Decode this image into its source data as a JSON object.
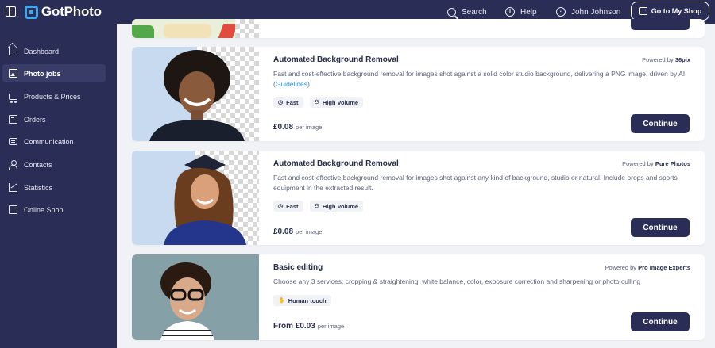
{
  "header": {
    "logo": "GotPhoto",
    "search_label": "Search",
    "help_label": "Help",
    "user_name": "John Johnson",
    "shop_button": "Go to My Shop"
  },
  "sidebar": {
    "items": [
      {
        "label": "Dashboard",
        "icon": "home-icon"
      },
      {
        "label": "Photo jobs",
        "icon": "photo-icon",
        "active": true
      },
      {
        "label": "Products & Prices",
        "icon": "cart-icon"
      },
      {
        "label": "Orders",
        "icon": "box-icon"
      },
      {
        "label": "Communication",
        "icon": "chat-icon"
      },
      {
        "label": "Contacts",
        "icon": "person-icon"
      },
      {
        "label": "Statistics",
        "icon": "stats-icon"
      },
      {
        "label": "Online Shop",
        "icon": "store-icon"
      }
    ]
  },
  "cards": [
    {
      "title": "Automated Background Removal",
      "powered_prefix": "Powered by",
      "powered_by": "36pix",
      "description": "Fast and cost-effective background removal for images shot against a solid color studio background, delivering a PNG image, driven by AI. (",
      "link": "Guidelines",
      "description_end": ")",
      "tags": [
        "Fast",
        "High Volume"
      ],
      "price": "£0.08",
      "price_unit": "per image",
      "button": "Continue"
    },
    {
      "title": "Automated Background Removal",
      "powered_prefix": "Powered by",
      "powered_by": "Pure Photos",
      "description": "Fast and cost-effective background removal for images shot against any kind of background, studio or natural. Include props and sports equipment in the extracted result.",
      "tags": [
        "Fast",
        "High Volume"
      ],
      "price": "£0.08",
      "price_unit": "per image",
      "button": "Continue"
    },
    {
      "title": "Basic editing",
      "powered_prefix": "Powered by",
      "powered_by": "Pro Image Experts",
      "description": "Choose any 3 services: cropping & straightening, white balance, color, exposure correction and sharpening or photo culling",
      "tags": [
        "Human touch"
      ],
      "price": "From £0.03",
      "price_unit": "per image",
      "button": "Continue"
    }
  ],
  "colors": {
    "navy": "#2a2d55",
    "accent_blue": "#43a6ea",
    "link": "#2b8fd6",
    "page_bg": "#f1f2f6"
  }
}
